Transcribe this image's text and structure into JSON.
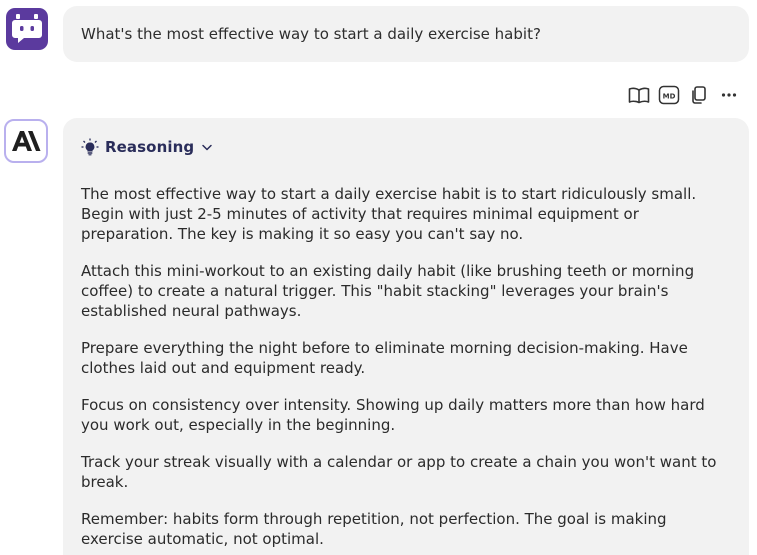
{
  "user": {
    "avatar_icon": "robot-icon",
    "avatar_color": "#5b3a9e",
    "message": "What's the most effective way to start a daily exercise habit?"
  },
  "toolbar": {
    "buttons": [
      "book-icon",
      "markdown-icon",
      "copy-icon",
      "more-icon"
    ],
    "markdown_label": "MD",
    "more_label": "···"
  },
  "assistant": {
    "avatar_icon": "anthropic-logo-icon",
    "avatar_border_color": "#b9b0ee",
    "reasoning_label": "Reasoning",
    "paragraphs": [
      "The most effective way to start a daily exercise habit is to start ridiculously small. Begin with just 2-5 minutes of activity that requires minimal equipment or preparation. The key is making it so easy you can't say no.",
      "Attach this mini-workout to an existing daily habit (like brushing teeth or morning coffee) to create a natural trigger. This \"habit stacking\" leverages your brain's established neural pathways.",
      "Prepare everything the night before to eliminate morning decision-making. Have clothes laid out and equipment ready.",
      "Focus on consistency over intensity. Showing up daily matters more than how hard you work out, especially in the beginning.",
      "Track your streak visually with a calendar or app to create a chain you won't want to break.",
      "Remember: habits form through repetition, not perfection. The goal is making exercise automatic, not optimal."
    ]
  }
}
